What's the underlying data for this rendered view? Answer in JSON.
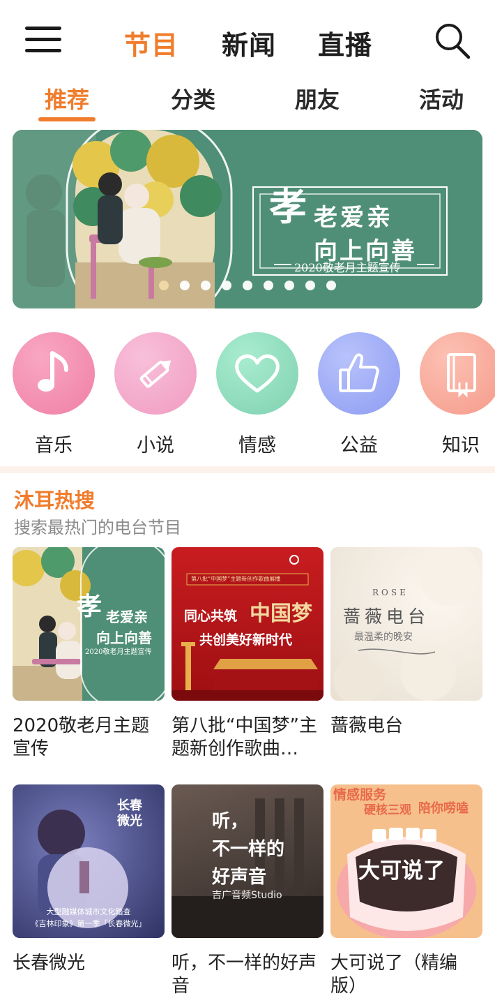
{
  "top_nav": {
    "tabs": [
      {
        "label": "节目",
        "active": true
      },
      {
        "label": "新闻",
        "active": false
      },
      {
        "label": "直播",
        "active": false
      }
    ]
  },
  "sub_nav": {
    "tabs": [
      {
        "label": "推荐",
        "active": true
      },
      {
        "label": "分类",
        "active": false
      },
      {
        "label": "朋友",
        "active": false
      },
      {
        "label": "活动",
        "active": false
      }
    ]
  },
  "banner": {
    "big_char": "孝",
    "line1": "老爱亲",
    "line2": "向上向善",
    "caption": "2020敬老月主题宣传",
    "dots_count": 9,
    "active_dot": 0
  },
  "categories": [
    {
      "label": "音乐",
      "icon": "music-note-icon",
      "color": "#f08cae"
    },
    {
      "label": "小说",
      "icon": "pencil-icon",
      "color": "#f2a2c4"
    },
    {
      "label": "情感",
      "icon": "heart-icon",
      "color": "#8fdbbd"
    },
    {
      "label": "公益",
      "icon": "thumbs-up-icon",
      "color": "#9aa8f4"
    },
    {
      "label": "知识",
      "icon": "book-icon",
      "color": "#f9a89a"
    }
  ],
  "section": {
    "title": "沐耳热搜",
    "subtitle": "搜索最热门的电台节目"
  },
  "cards": [
    {
      "title": "2020敬老月主题宣传",
      "thumb_text": [
        "孝",
        "老爱亲",
        "向上向善",
        "2020敬老月主题宣传"
      ]
    },
    {
      "title": "第八批“中国梦”主题新创作歌曲…",
      "thumb_text": [
        "第八批“中国梦”主题新创作歌曲展播",
        "同心共筑",
        "中国梦",
        "共创美好新时代"
      ]
    },
    {
      "title": "蔷薇电台",
      "thumb_text": [
        "ROSE",
        "蔷薇电台",
        "最温柔的晚安"
      ]
    },
    {
      "title": "长春微光",
      "thumb_text": [
        "长春微光",
        "大型融媒体城市文化踏查",
        "《吉林印象》第一季「长春微光」"
      ]
    },
    {
      "title": "听，不一样的好声音",
      "thumb_text": [
        "听，",
        "不一样的",
        "好声音",
        "吉广音频Studio"
      ]
    },
    {
      "title": "大可说了（精编版）",
      "thumb_text": [
        "大可说了",
        "情感服务",
        "硬核三观",
        "陪你唠嗑"
      ]
    }
  ],
  "colors": {
    "accent": "#f07c2c",
    "banner_green": "#4f8f77"
  }
}
